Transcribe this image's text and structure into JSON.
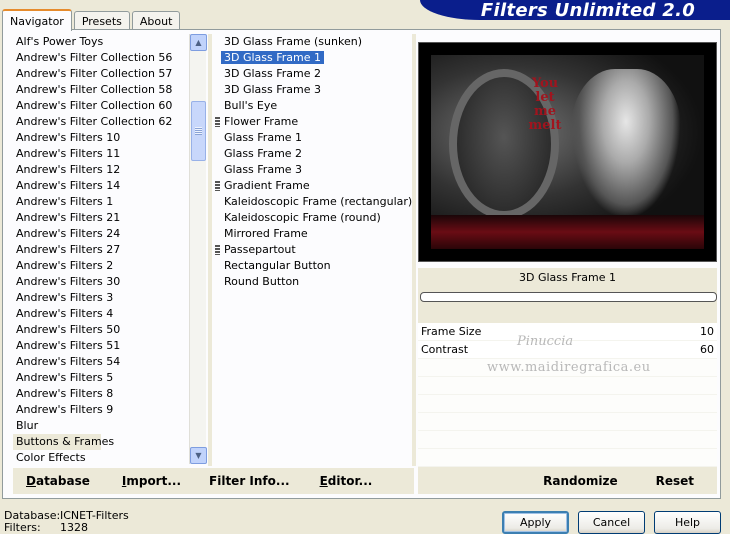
{
  "tabs": [
    "Navigator",
    "Presets",
    "About"
  ],
  "brand_title": "Filters Unlimited 2.0",
  "categories": [
    "Alf's Power Toys",
    "Andrew's Filter Collection 56",
    "Andrew's Filter Collection 57",
    "Andrew's Filter Collection 58",
    "Andrew's Filter Collection 60",
    "Andrew's Filter Collection 62",
    "Andrew's Filters 10",
    "Andrew's Filters 11",
    "Andrew's Filters 12",
    "Andrew's Filters 14",
    "Andrew's Filters 1",
    "Andrew's Filters 21",
    "Andrew's Filters 24",
    "Andrew's Filters 27",
    "Andrew's Filters 2",
    "Andrew's Filters 30",
    "Andrew's Filters 3",
    "Andrew's Filters 4",
    "Andrew's Filters 50",
    "Andrew's Filters 51",
    "Andrew's Filters 54",
    "Andrew's Filters 5",
    "Andrew's Filters 8",
    "Andrew's Filters 9",
    "Blur",
    "Buttons & Frames",
    "Color Effects"
  ],
  "selected_category": "Buttons & Frames",
  "filters": [
    "3D Glass Frame (sunken)",
    "3D Glass Frame 1",
    "3D Glass Frame 2",
    "3D Glass Frame 3",
    "Bull's Eye",
    "Flower Frame",
    "Glass Frame 1",
    "Glass Frame 2",
    "Glass Frame 3",
    "Gradient Frame",
    "Kaleidoscopic Frame (rectangular)",
    "Kaleidoscopic Frame (round)",
    "Mirrored Frame",
    "Passepartout",
    "Rectangular Button",
    "Round Button"
  ],
  "selected_filter": "3D Glass Frame 1",
  "preview_text": [
    "You",
    "let me",
    "melt"
  ],
  "params": [
    {
      "name": "Frame Size",
      "value": "10"
    },
    {
      "name": "Contrast",
      "value": "60"
    }
  ],
  "watermark": {
    "line1": "Pinuccia",
    "line2": "www.maidiregrafica.eu"
  },
  "left_buttons": [
    {
      "label_u": "D",
      "label_rest": "atabase"
    },
    {
      "label_u": "I",
      "label_rest": "mport..."
    },
    {
      "label_u": "",
      "label_rest": "Filter Info..."
    },
    {
      "label_u": "E",
      "label_rest": "ditor..."
    }
  ],
  "right_buttons": [
    "Randomize",
    "Reset"
  ],
  "status": {
    "database_label": "Database:",
    "database_value": "ICNET-Filters",
    "filters_label": "Filters:",
    "filters_value": "1328"
  },
  "dialog_buttons": [
    "Apply",
    "Cancel",
    "Help"
  ]
}
